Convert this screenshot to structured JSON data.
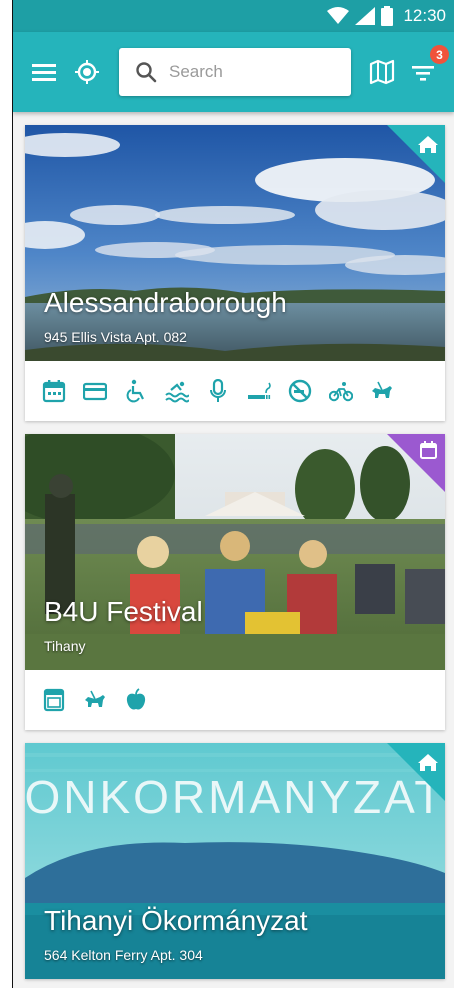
{
  "status_bar": {
    "time": "12:30"
  },
  "app_bar": {
    "search": {
      "placeholder": "Search",
      "value": ""
    },
    "filter_badge_count": "3",
    "accent_color": "#25b4bb",
    "badge_color": "#f0533b"
  },
  "cards": [
    {
      "type": "place",
      "corner_icon": "home-icon",
      "corner_color": "#25b4bb",
      "title": "Alessandraborough",
      "subtitle": "945 Ellis Vista Apt. 082",
      "amenities": [
        "calendar-icon",
        "credit-card-icon",
        "wheelchair-icon",
        "swimming-icon",
        "microphone-icon",
        "smoking-icon",
        "no-smoking-icon",
        "bicycle-icon",
        "guide-dog-icon"
      ]
    },
    {
      "type": "event",
      "corner_icon": "calendar-icon",
      "corner_color": "#9b59d0",
      "title": "B4U Festival",
      "subtitle": "Tihany",
      "amenities": [
        "oven-icon",
        "guide-dog-icon",
        "apple-icon"
      ]
    },
    {
      "type": "place",
      "corner_icon": "home-icon",
      "corner_color": "#25b4bb",
      "title": "Tihanyi Ökormányzat",
      "subtitle": "564 Kelton Ferry Apt. 304",
      "image_text": "ONKORMANYZAT",
      "amenities": []
    }
  ]
}
